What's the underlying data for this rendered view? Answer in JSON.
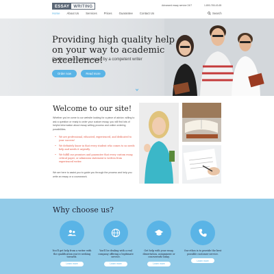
{
  "header": {
    "logo_part1": "ESSAY",
    "logo_part2": "WRITING",
    "support_text": "Advanced essay service 24/7",
    "phone": "1-800-765-43-65",
    "nav": [
      {
        "label": "Home",
        "active": true
      },
      {
        "label": "About Us",
        "active": false
      },
      {
        "label": "Services",
        "active": false
      },
      {
        "label": "Prices",
        "active": false
      },
      {
        "label": "Guarantee",
        "active": false
      },
      {
        "label": "Contact Us",
        "active": false
      }
    ],
    "search_label": "Search"
  },
  "hero": {
    "title": "Providing high quality help on your way to academic excellence!",
    "subtitle": "Crafting your custom essay by a competent writer",
    "order_button": "Order now",
    "read_more_button": "Read more"
  },
  "welcome": {
    "title": "Welcome to our site!",
    "intro": "Whether you've come to our website looking for a piece of advice, willing to ask a question or ready to order your custom essay, you will find lots of helpful information about essay writing process and online ordering possibilities.",
    "bullets": [
      "We are professional, educated, experienced, and dedicated to your success!",
      "We definitely know in that every student who comes to us needs help and needs it urgently.",
      "We fulfill our promises and guarantee that every custom essay, critical paper, or admission statement is written from experienced writer."
    ],
    "outro": "We are here to assist you to guide you through the process and help you write an essay or a coursework."
  },
  "why": {
    "title": "Why choose us?",
    "features": [
      {
        "icon": "users-icon",
        "text": "You'll get help from a writer with the qualification you're seeking towards.",
        "button": "Learn more"
      },
      {
        "icon": "globe-icon",
        "text": "You'll be dealing with a real company offering a legitimate service.",
        "button": "Learn more"
      },
      {
        "icon": "graduation-cap-icon",
        "text": "Get help with your essay, dissertation, assignment or coursework today.",
        "button": "Learn more"
      },
      {
        "icon": "phone-icon",
        "text": "Our ethos is to provide the best possible customer service.",
        "button": "Learn more"
      }
    ]
  },
  "colors": {
    "accent": "#5ab4e6",
    "why_background": "#92cbe8",
    "bullet_red": "#e2533f"
  }
}
